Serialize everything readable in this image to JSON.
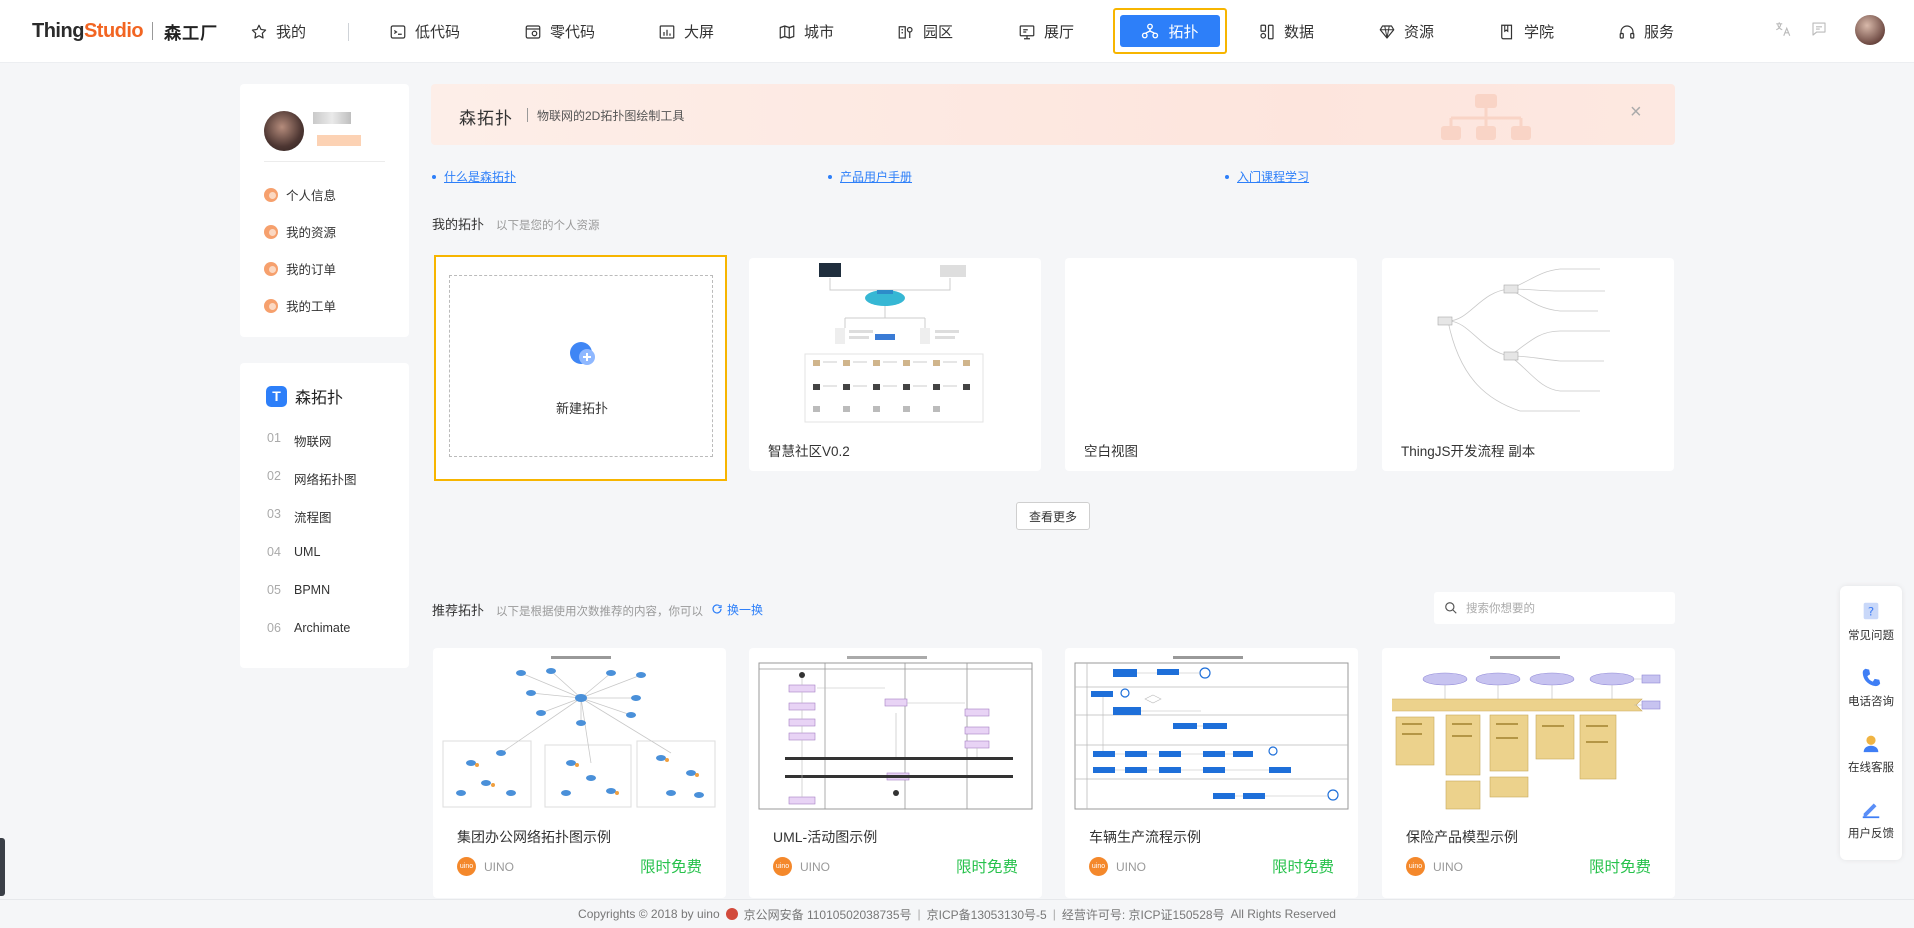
{
  "brand": {
    "part1": "Thing",
    "part2": "Studio",
    "cn": "森工厂"
  },
  "nav": [
    {
      "label": "我的",
      "icon": "star-icon"
    },
    {
      "label": "低代码",
      "icon": "code-window-icon"
    },
    {
      "label": "零代码",
      "icon": "browser-gear-icon"
    },
    {
      "label": "大屏",
      "icon": "bar-chart-icon"
    },
    {
      "label": "城市",
      "icon": "map-icon"
    },
    {
      "label": "园区",
      "icon": "campus-icon"
    },
    {
      "label": "展厅",
      "icon": "monitor-icon"
    },
    {
      "label": "拓扑",
      "icon": "topology-icon"
    },
    {
      "label": "数据",
      "icon": "data-icon"
    },
    {
      "label": "资源",
      "icon": "diamond-icon"
    },
    {
      "label": "学院",
      "icon": "book-icon"
    },
    {
      "label": "服务",
      "icon": "headset-icon"
    }
  ],
  "profile_menu": [
    "个人信息",
    "我的资源",
    "我的订单",
    "我的工单"
  ],
  "category": {
    "title": "森拓扑",
    "logo_letter": "T",
    "items": [
      {
        "num": "01",
        "label": "物联网"
      },
      {
        "num": "02",
        "label": "网络拓扑图"
      },
      {
        "num": "03",
        "label": "流程图"
      },
      {
        "num": "04",
        "label": "UML"
      },
      {
        "num": "05",
        "label": "BPMN"
      },
      {
        "num": "06",
        "label": "Archimate"
      }
    ]
  },
  "banner": {
    "title": "森拓扑",
    "subtitle": "物联网的2D拓扑图绘制工具",
    "close": "×"
  },
  "links": [
    "什么是森拓扑",
    "产品用户手册",
    "入门课程学习"
  ],
  "my_section": {
    "title": "我的拓扑",
    "subtitle": "以下是您的个人资源"
  },
  "new_tile_label": "新建拓扑",
  "my_tiles": [
    "智慧社区V0.2",
    "空白视图",
    "ThingJS开发流程 副本"
  ],
  "more_button": "查看更多",
  "rec_section": {
    "title": "推荐拓扑",
    "subtitle": "以下是根据使用次数推荐的内容，你可以",
    "swap": "换一换"
  },
  "search": {
    "placeholder": "搜索你想要的"
  },
  "rec_tiles": [
    {
      "name": "集团办公网络拓扑图示例",
      "author": "UINO",
      "price": "限时免费"
    },
    {
      "name": "UML-活动图示例",
      "author": "UINO",
      "price": "限时免费"
    },
    {
      "name": "车辆生产流程示例",
      "author": "UINO",
      "price": "限时免费"
    },
    {
      "name": "保险产品模型示例",
      "author": "UINO",
      "price": "限时免费"
    }
  ],
  "author_logo": "uino",
  "float_menu": [
    "常见问题",
    "电话咨询",
    "在线客服",
    "用户反馈"
  ],
  "footer": {
    "copy": "Copyrights © 2018 by uino",
    "police": "京公网安备 11010502038735号",
    "icp": "京ICP备13053130号-5",
    "license": "经营许可号: 京ICP证150528号",
    "rights": "All Rights Reserved"
  },
  "colors": {
    "accent": "#2d7ff9",
    "highlight": "#f7b500",
    "brand_orange": "#f26522",
    "free_green": "#27c24c"
  }
}
